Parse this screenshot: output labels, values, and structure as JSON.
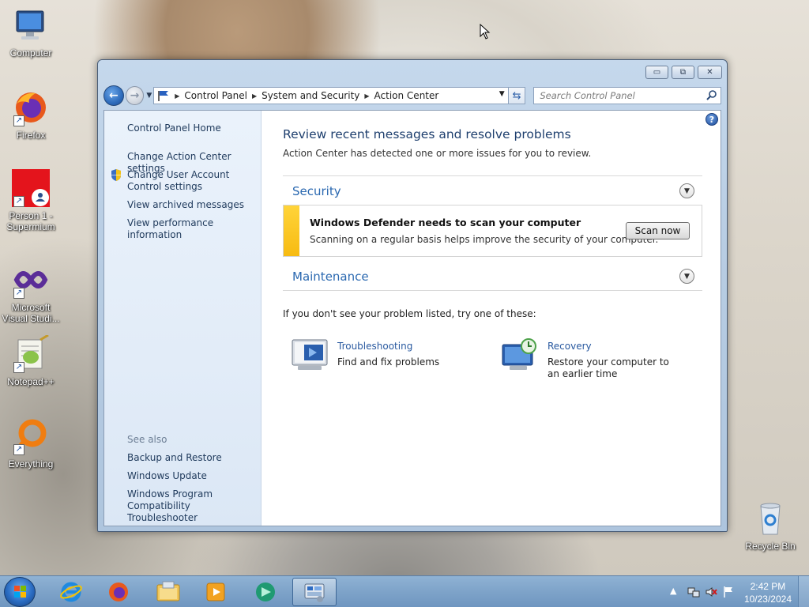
{
  "desktop": {
    "icons": [
      {
        "label": "Computer",
        "icon": "computer-icon"
      },
      {
        "label": "Firefox",
        "icon": "firefox-icon"
      },
      {
        "label": "Person 1 - Supermium",
        "icon": "supermium-icon"
      },
      {
        "label": "Microsoft Visual Studi...",
        "icon": "visual-studio-icon"
      },
      {
        "label": "Notepad++",
        "icon": "notepadpp-icon"
      },
      {
        "label": "Everything",
        "icon": "everything-icon"
      },
      {
        "label": "Recycle Bin",
        "icon": "recycle-bin-icon"
      }
    ]
  },
  "window": {
    "title": "Action Center",
    "breadcrumb": [
      "Control Panel",
      "System and Security",
      "Action Center"
    ],
    "search_placeholder": "Search Control Panel",
    "sidebar": {
      "home": "Control Panel Home",
      "links": [
        "Change Action Center settings",
        "Change User Account Control settings",
        "View archived messages",
        "View performance information"
      ],
      "see_also_label": "See also",
      "see_also": [
        "Backup and Restore",
        "Windows Update",
        "Windows Program Compatibility Troubleshooter"
      ]
    },
    "main": {
      "title": "Review recent messages and resolve problems",
      "subtitle": "Action Center has detected one or more issues for you to review.",
      "security": {
        "title": "Security",
        "alert_title": "Windows Defender needs to scan your computer",
        "alert_desc": "Scanning on a regular basis helps improve the security of your computer.",
        "button": "Scan now",
        "alert_color": "#f9c51a"
      },
      "maintenance": {
        "title": "Maintenance"
      },
      "try_text": "If you don't see your problem listed, try one of these:",
      "tools": [
        {
          "link": "Troubleshooting",
          "desc": "Find and fix problems",
          "icon": "troubleshooting-icon"
        },
        {
          "link": "Recovery",
          "desc": "Restore your computer to an earlier time",
          "icon": "recovery-icon"
        }
      ]
    }
  },
  "taskbar": {
    "items": [
      "internet-explorer-icon",
      "firefox-icon",
      "file-explorer-icon",
      "media-player-icon",
      "app-icon",
      "control-panel-icon"
    ],
    "time": "2:42 PM",
    "date": "10/23/2024"
  }
}
